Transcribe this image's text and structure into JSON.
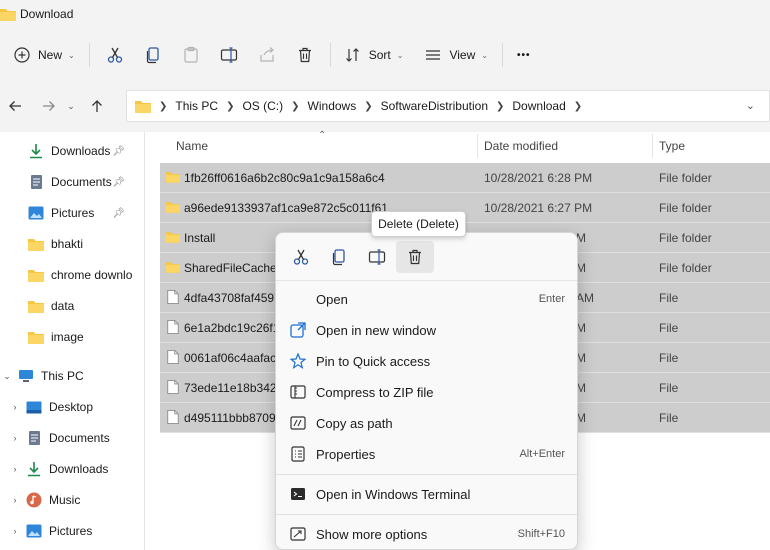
{
  "window": {
    "title": "Download"
  },
  "toolbar": {
    "new_label": "New",
    "sort_label": "Sort",
    "view_label": "View",
    "more_label": "•••"
  },
  "address": {
    "crumbs": [
      "This PC",
      "OS (C:)",
      "Windows",
      "SoftwareDistribution",
      "Download"
    ]
  },
  "sidebar": {
    "quick": [
      {
        "label": "Downloads",
        "icon": "download-icon",
        "pinned": true
      },
      {
        "label": "Documents",
        "icon": "documents-icon",
        "pinned": true
      },
      {
        "label": "Pictures",
        "icon": "pictures-icon",
        "pinned": true
      },
      {
        "label": "bhakti",
        "icon": "folder-icon"
      },
      {
        "label": "chrome downlo",
        "icon": "folder-icon"
      },
      {
        "label": "data",
        "icon": "folder-icon"
      },
      {
        "label": "image",
        "icon": "folder-icon"
      }
    ],
    "this_pc": "This PC",
    "pc_items": [
      {
        "label": "Desktop",
        "icon": "desktop-icon"
      },
      {
        "label": "Documents",
        "icon": "documents-icon"
      },
      {
        "label": "Downloads",
        "icon": "download-icon"
      },
      {
        "label": "Music",
        "icon": "music-icon"
      },
      {
        "label": "Pictures",
        "icon": "pictures-icon"
      }
    ]
  },
  "columns": {
    "name": "Name",
    "date": "Date modified",
    "type": "Type"
  },
  "rows": [
    {
      "name": "1fb26ff0616a6b2c80c9a1c9a158a6c4",
      "date": "10/28/2021 6:28 PM",
      "type": "File folder",
      "kind": "folder"
    },
    {
      "name": "a96ede9133937af1ca9e872c5c011f61",
      "date": "10/28/2021 6:27 PM",
      "type": "File folder",
      "kind": "folder"
    },
    {
      "name": "Install",
      "date": "M",
      "type": "File folder",
      "kind": "folder"
    },
    {
      "name": "SharedFileCache",
      "date": "M",
      "type": "File folder",
      "kind": "folder"
    },
    {
      "name": "4dfa43708faf4597",
      "date": "AM",
      "type": "File",
      "kind": "file"
    },
    {
      "name": "6e1a2bdc19c26f1!",
      "date": "M",
      "type": "File",
      "kind": "file"
    },
    {
      "name": "0061af06c4aafac5",
      "date": "M",
      "type": "File",
      "kind": "file"
    },
    {
      "name": "73ede11e18b3425",
      "date": "M",
      "type": "File",
      "kind": "file"
    },
    {
      "name": "d495111bbb8709e",
      "date": "M",
      "type": "File",
      "kind": "file"
    }
  ],
  "tooltip": {
    "text": "Delete (Delete)"
  },
  "context_menu": {
    "items": [
      {
        "label": "Open",
        "shortcut": "Enter",
        "icon": "open-icon"
      },
      {
        "label": "Open in new window",
        "shortcut": "",
        "icon": "new-window-icon"
      },
      {
        "label": "Pin to Quick access",
        "shortcut": "",
        "icon": "star-icon"
      },
      {
        "label": "Compress to ZIP file",
        "shortcut": "",
        "icon": "zip-icon"
      },
      {
        "label": "Copy as path",
        "shortcut": "",
        "icon": "copy-path-icon"
      },
      {
        "label": "Properties",
        "shortcut": "Alt+Enter",
        "icon": "properties-icon"
      },
      {
        "label": "Open in Windows Terminal",
        "shortcut": "",
        "icon": "terminal-icon"
      },
      {
        "label": "Show more options",
        "shortcut": "Shift+F10",
        "icon": "more-options-icon"
      }
    ]
  },
  "colors": {
    "folder": "#f7c642",
    "selection": "#cdcdcd",
    "accent": "#1a6fd1"
  }
}
